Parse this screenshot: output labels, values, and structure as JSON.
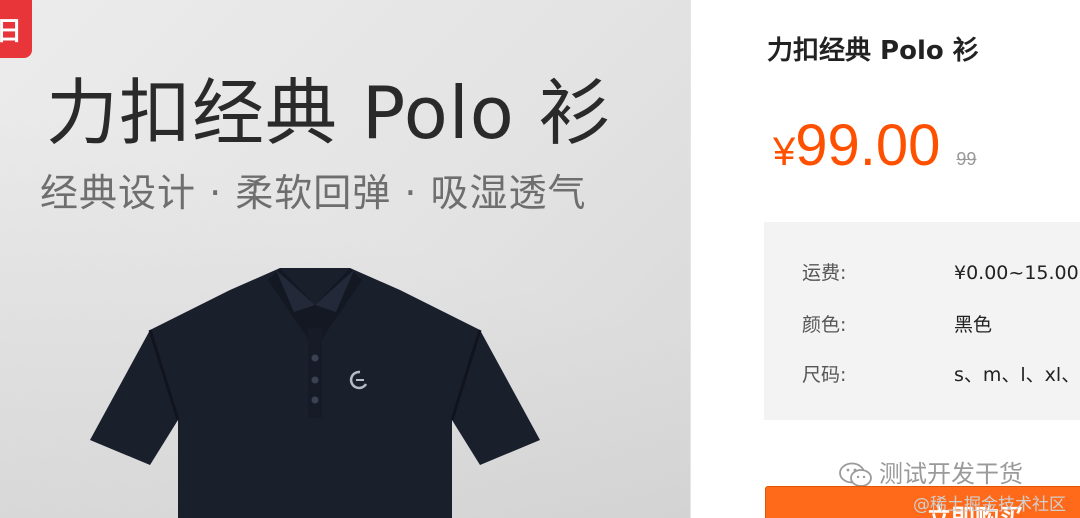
{
  "product_image": {
    "corner_badge": "日",
    "banner_title": "力扣经典 Polo 衫",
    "banner_subtitle": "经典设计 · 柔软回弹 · 吸湿透气",
    "shirt_color": "#1a1f2c"
  },
  "product": {
    "name": "力扣经典 Polo 衫",
    "price_symbol": "¥",
    "price": "99.00",
    "original_price": "99"
  },
  "specs": [
    {
      "label": "运费:",
      "value": "¥0.00~15.00"
    },
    {
      "label": "颜色:",
      "value": "黑色"
    },
    {
      "label": "尺码:",
      "value": "s、m、l、xl、"
    }
  ],
  "watermark": {
    "wechat_text": "测试开发干货",
    "site_text": "@稀土掘金技术社区"
  },
  "buy_button_label": "立即购买",
  "colors": {
    "accent": "#ff5000",
    "button": "#ff6a1a",
    "badge": "#e8353a"
  }
}
